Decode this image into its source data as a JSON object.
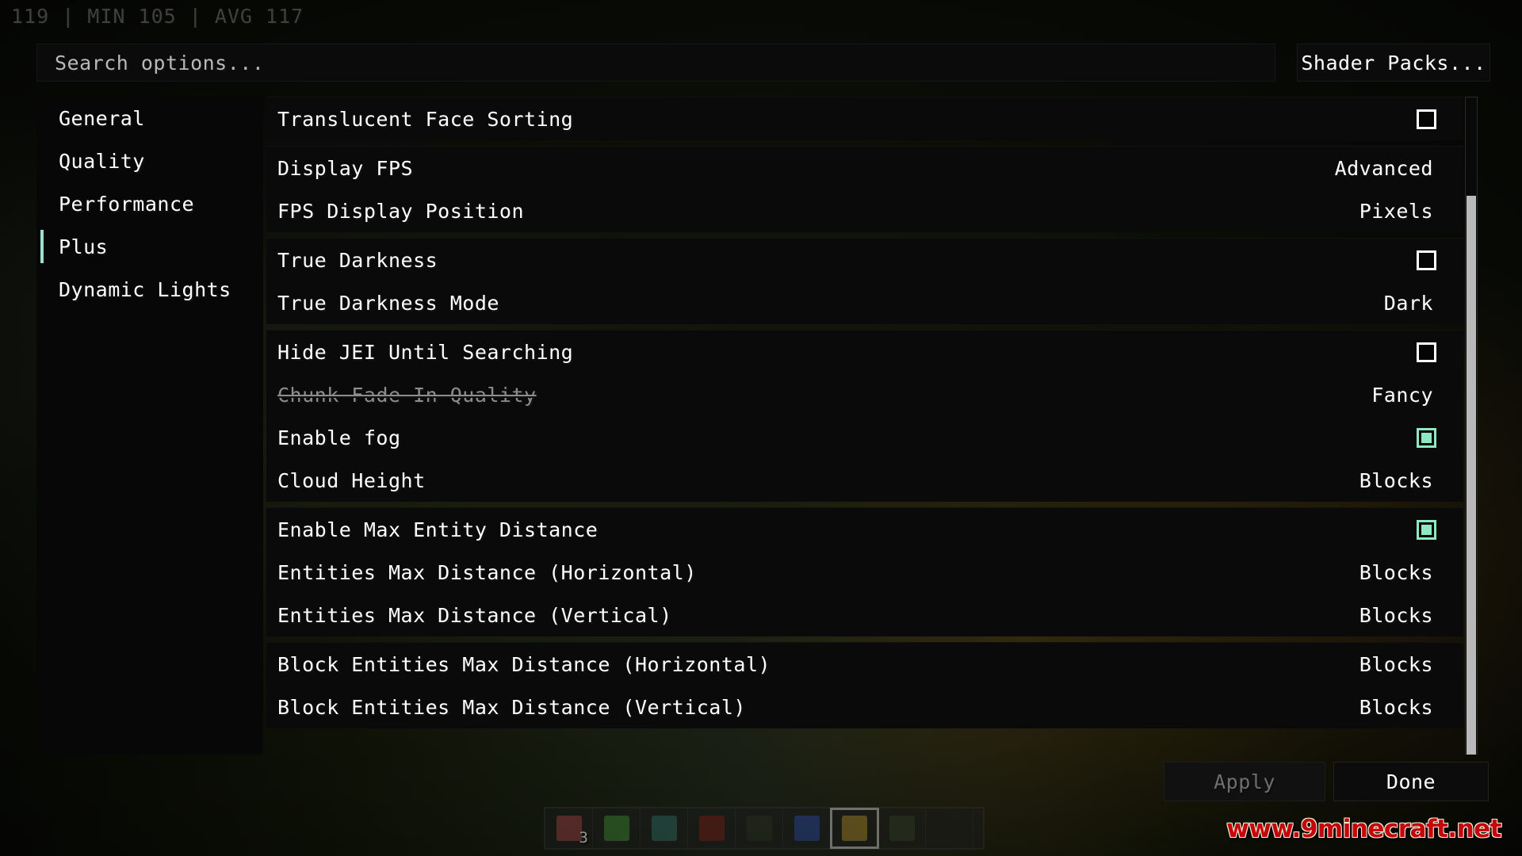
{
  "hud": {
    "fps_counter": "119 | MIN 105 | AVG 117",
    "watermark": "www.9minecraft.net"
  },
  "colors": {
    "accent_teal": "#9ae0ce",
    "checkbox_on": "#8de8c4",
    "text_primary": "#ffffff",
    "text_disabled": "#8d8d8d",
    "watermark_red": "#c4070c"
  },
  "topbar": {
    "search_placeholder": "Search options...",
    "shader_packs_label": "Shader Packs..."
  },
  "sidebar": {
    "items": [
      {
        "label": "General",
        "selected": false
      },
      {
        "label": "Quality",
        "selected": false
      },
      {
        "label": "Performance",
        "selected": false
      },
      {
        "label": "Plus",
        "selected": true
      },
      {
        "label": "Dynamic Lights",
        "selected": false
      }
    ]
  },
  "options": {
    "groups": [
      {
        "rows": [
          {
            "name": "Translucent Face Sorting",
            "control": "checkbox",
            "checked": false,
            "disabled": false
          }
        ]
      },
      {
        "rows": [
          {
            "name": "Display FPS",
            "control": "value",
            "value": "Advanced",
            "disabled": false
          },
          {
            "name": "FPS Display Position",
            "control": "value",
            "value": "Pixels",
            "disabled": false
          }
        ]
      },
      {
        "rows": [
          {
            "name": "True Darkness",
            "control": "checkbox",
            "checked": false,
            "disabled": false
          },
          {
            "name": "True Darkness Mode",
            "control": "value",
            "value": "Dark",
            "disabled": false
          }
        ]
      },
      {
        "rows": [
          {
            "name": "Hide JEI Until Searching",
            "control": "checkbox",
            "checked": false,
            "disabled": false
          },
          {
            "name": "Chunk Fade In Quality",
            "control": "value",
            "value": "Fancy",
            "disabled": true
          },
          {
            "name": "Enable fog",
            "control": "checkbox",
            "checked": true,
            "disabled": false
          },
          {
            "name": "Cloud Height",
            "control": "value",
            "value": "Blocks",
            "disabled": false
          }
        ]
      },
      {
        "rows": [
          {
            "name": "Enable Max Entity Distance",
            "control": "checkbox",
            "checked": true,
            "disabled": false
          },
          {
            "name": "Entities Max Distance (Horizontal)",
            "control": "value",
            "value": "Blocks",
            "disabled": false
          },
          {
            "name": "Entities Max Distance (Vertical)",
            "control": "value",
            "value": "Blocks",
            "disabled": false
          }
        ]
      },
      {
        "rows": [
          {
            "name": "Block Entities Max Distance (Horizontal)",
            "control": "value",
            "value": "Blocks",
            "disabled": false
          },
          {
            "name": "Block Entities Max Distance (Vertical)",
            "control": "value",
            "value": "Blocks",
            "disabled": false
          }
        ]
      }
    ]
  },
  "footer": {
    "apply_label": "Apply",
    "apply_disabled": true,
    "done_label": "Done",
    "done_disabled": false
  },
  "hotbar": {
    "selected_slot": 7,
    "slots": [
      {
        "item": "raw-beef",
        "count": "3",
        "color": "#a5424a"
      },
      {
        "item": "kelp",
        "count": "",
        "color": "#3f8f33"
      },
      {
        "item": "prismarine-block",
        "count": "",
        "color": "#2f6f68"
      },
      {
        "item": "nether-wart-block",
        "count": "",
        "color": "#7a1f18"
      },
      {
        "item": "dark-block",
        "count": "",
        "color": "#2a2f24"
      },
      {
        "item": "water-bucket",
        "count": "",
        "color": "#2b49a8"
      },
      {
        "item": "torch",
        "count": "",
        "color": "#b08a2e"
      },
      {
        "item": "green-block",
        "count": "",
        "color": "#31402c"
      },
      {
        "item": "",
        "count": "",
        "color": ""
      }
    ]
  }
}
